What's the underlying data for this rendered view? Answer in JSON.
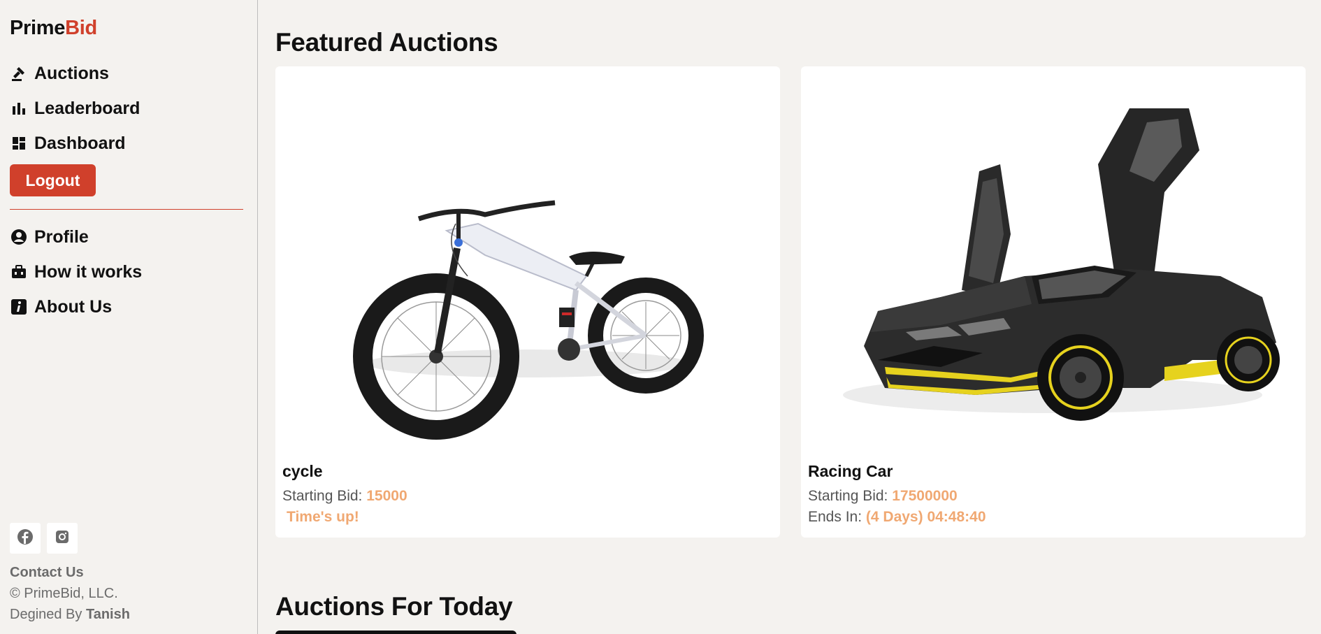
{
  "brand": {
    "name_part1": "Prime",
    "name_part2": "Bid"
  },
  "nav": [
    {
      "label": "Auctions",
      "icon": "gavel-icon"
    },
    {
      "label": "Leaderboard",
      "icon": "bar-chart-icon"
    },
    {
      "label": "Dashboard",
      "icon": "dashboard-icon"
    }
  ],
  "logout_label": "Logout",
  "nav2": [
    {
      "label": "Profile",
      "icon": "user-circle-icon"
    },
    {
      "label": "How it works",
      "icon": "briefcase-icon"
    },
    {
      "label": "About Us",
      "icon": "info-icon"
    }
  ],
  "social": [
    "facebook-icon",
    "instagram-icon"
  ],
  "footer": {
    "contact": "Contact Us",
    "copyright": "© PrimeBid, LLC.",
    "designed_prefix": "Degined By",
    "designed_name": "Tanish"
  },
  "featured": {
    "title": "Featured Auctions",
    "cards": [
      {
        "title": "cycle",
        "bid_label": "Starting Bid:",
        "bid_value": "15000",
        "status": "Time's up!"
      },
      {
        "title": "Racing Car",
        "bid_label": "Starting Bid:",
        "bid_value": "17500000",
        "ends_label": "Ends In:",
        "ends_value": "(4 Days) 04:48:40"
      }
    ]
  },
  "today": {
    "title": "Auctions For Today"
  },
  "colors": {
    "accent": "#d0402b",
    "highlight": "#f0a872",
    "background": "#f4f2ef"
  }
}
